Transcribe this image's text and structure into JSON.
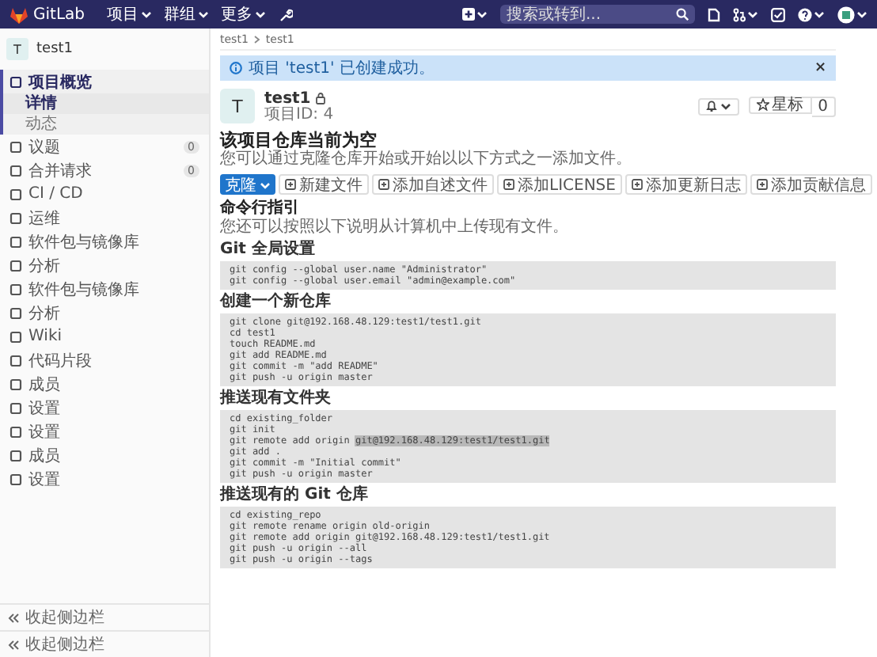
{
  "header": {
    "brand": "GitLab",
    "menus": [
      {
        "label": "项目"
      },
      {
        "label": "群组"
      },
      {
        "label": "更多"
      }
    ],
    "search": {
      "placeholder": "搜索或转到..."
    }
  },
  "breadcrumb": [
    "test1",
    "test1"
  ],
  "sidebar": {
    "project": {
      "avatar": "T",
      "name": "test1"
    },
    "items": [
      {
        "label": "项目概览",
        "selected": true,
        "expanded": true,
        "children": [
          {
            "label": "详情",
            "selected": true
          },
          {
            "label": "动态",
            "selected": false
          }
        ]
      },
      {
        "label": "议题",
        "count": "0",
        "selected": false
      },
      {
        "label": "合并请求",
        "count": "0",
        "selected": false
      },
      {
        "label": "CI / CD",
        "selected": false
      },
      {
        "label": "运维",
        "selected": false
      },
      {
        "label": "软件包与镜像库",
        "selected": false
      },
      {
        "label": "分析",
        "selected": false
      },
      {
        "label": "软件包与镜像库",
        "selected": false
      },
      {
        "label": "分析",
        "selected": false
      },
      {
        "label": "Wiki",
        "selected": false
      },
      {
        "label": "代码片段",
        "selected": false
      },
      {
        "label": "成员",
        "selected": false
      },
      {
        "label": "设置",
        "selected": false
      },
      {
        "label": "设置",
        "selected": false
      },
      {
        "label": "成员",
        "selected": false
      },
      {
        "label": "设置",
        "selected": false
      }
    ],
    "collapse": [
      "收起侧边栏",
      "收起侧边栏"
    ]
  },
  "alert": {
    "message": "项目 'test1' 已创建成功。",
    "close": "×"
  },
  "project": {
    "avatar": "T",
    "name": "test1",
    "private": true,
    "id": "项目ID: 4",
    "star": {
      "label": "星标",
      "count": "0"
    }
  },
  "empty": {
    "title": "该项目仓库当前为空",
    "text": "您可以通过克隆仓库开始或开始以以下方式之一添加文件。",
    "buttons": [
      {
        "label": "克隆",
        "kind": "primary"
      },
      {
        "label": "新建文件",
        "kind": "add"
      },
      {
        "label": "添加自述文件",
        "kind": "add"
      },
      {
        "label": "添加LICENSE",
        "kind": "add"
      },
      {
        "label": "添加更新日志",
        "kind": "add"
      },
      {
        "label": "添加贡献信息",
        "kind": "add"
      }
    ]
  },
  "guide": {
    "title": "命令行指引",
    "text": "您还可以按照以下说明从计算机中上传现有文件。",
    "sections": [
      {
        "label": "Git 全局设置",
        "lines": [
          "git config --global user.name \"Administrator\"",
          "git config --global user.email \"admin@example.com\""
        ]
      },
      {
        "label": "创建一个新仓库",
        "lines": [
          "git clone git@192.168.48.129:test1/test1.git",
          "cd test1",
          "touch README.md",
          "git add README.md",
          "git commit -m \"add README\"",
          "git push -u origin master"
        ]
      },
      {
        "label": "推送现有文件夹",
        "lines": [
          "cd existing_folder",
          "git init",
          {
            "text": "git remote add origin ",
            "selected_text": "git@192.168.48.129:test1/test1.git"
          },
          "git add .",
          "git commit -m \"Initial commit\"",
          "git push -u origin master"
        ]
      },
      {
        "label": "推送现有的 Git 仓库",
        "lines": [
          "cd existing_repo",
          "git remote rename origin old-origin",
          "git remote add origin git@192.168.48.129:test1/test1.git",
          "git push -u origin --all",
          "git push -u origin --tags"
        ]
      }
    ]
  }
}
